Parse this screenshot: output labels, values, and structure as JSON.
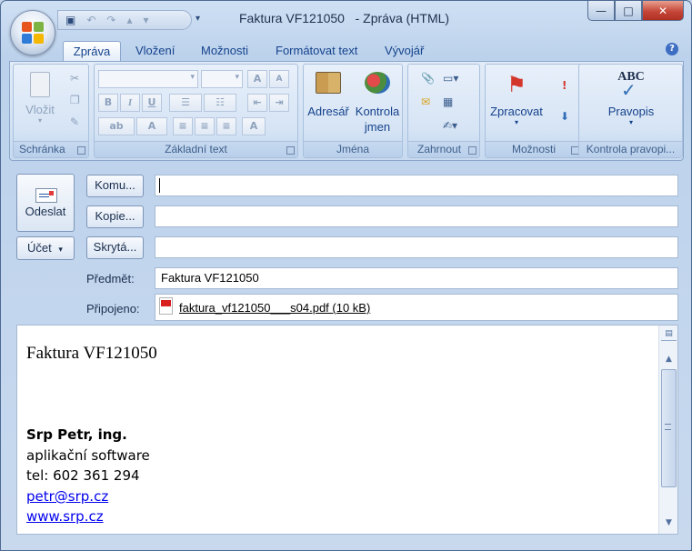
{
  "window": {
    "title": "Faktura VF121050   - Zpráva (HTML)"
  },
  "quick_access": {
    "icons": [
      "save-icon",
      "undo-icon",
      "redo-icon",
      "up-icon",
      "down-icon",
      "customize-icon"
    ]
  },
  "tabs": [
    "Zpráva",
    "Vložení",
    "Možnosti",
    "Formátovat text",
    "Vývojář"
  ],
  "ribbon": {
    "groups": {
      "clipboard": {
        "label": "Schránka",
        "paste": "Vložit"
      },
      "basic_text": {
        "label": "Základní text"
      },
      "names": {
        "label": "Jména",
        "address_book": "Adresář",
        "check_names_1": "Kontrola",
        "check_names_2": "jmen"
      },
      "include": {
        "label": "Zahrnout"
      },
      "options": {
        "label": "Možnosti",
        "follow_up": "Zpracovat"
      },
      "proofing": {
        "label": "Kontrola pravopi...",
        "spelling": "Pravopis",
        "abc": "ABC"
      }
    }
  },
  "compose": {
    "send_label": "Odeslat",
    "account_label": "Účet",
    "to_label": "Komu...",
    "cc_label": "Kopie...",
    "bcc_label": "Skrytá...",
    "to_value": "",
    "cc_value": "",
    "bcc_value": "",
    "subject_label": "Předmět:",
    "subject_value": "Faktura VF121050",
    "attached_label": "Připojeno:",
    "attachment_name": "faktura_vf121050___s04.pdf (10 kB)"
  },
  "message": {
    "title": "Faktura VF121050",
    "signature": {
      "name": "Srp Petr, ing.",
      "line1": "aplikační software",
      "phone": "tel: 602 361 294",
      "email": "petr@srp.cz",
      "web": "www.srp.cz"
    }
  },
  "colors": {
    "accent": "#15428b",
    "link": "#0000ee",
    "close_button": "#c5473a"
  }
}
